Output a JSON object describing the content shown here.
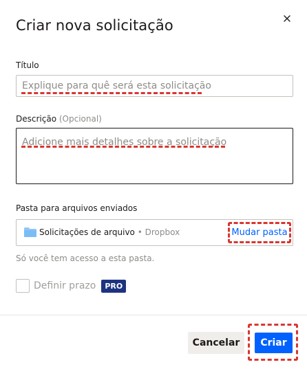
{
  "dialog": {
    "title": "Criar nova solicitação",
    "close_icon": "close-icon"
  },
  "form": {
    "title_field": {
      "label": "Título",
      "value": "",
      "placeholder": "Explique para quê será esta solicitação"
    },
    "description_field": {
      "label": "Descrição",
      "optional_text": "(Opcional)",
      "value": "",
      "placeholder": "Adicione mais detalhes sobre a solicitação"
    },
    "folder": {
      "label": "Pasta para arquivos enviados",
      "folder_icon": "folder-icon",
      "folder_name": "Solicitações de arquivo",
      "separator": "•",
      "root_name": "Dropbox",
      "change_label": "Mudar pasta",
      "access_note": "Só você tem acesso a esta pasta."
    },
    "deadline": {
      "label": "Definir prazo",
      "checked": false,
      "badge": "PRO"
    }
  },
  "footer": {
    "cancel_label": "Cancelar",
    "create_label": "Criar"
  },
  "colors": {
    "accent": "#0061fe",
    "pro_badge": "#1e3380",
    "highlight_dashes": "#d8362f"
  }
}
